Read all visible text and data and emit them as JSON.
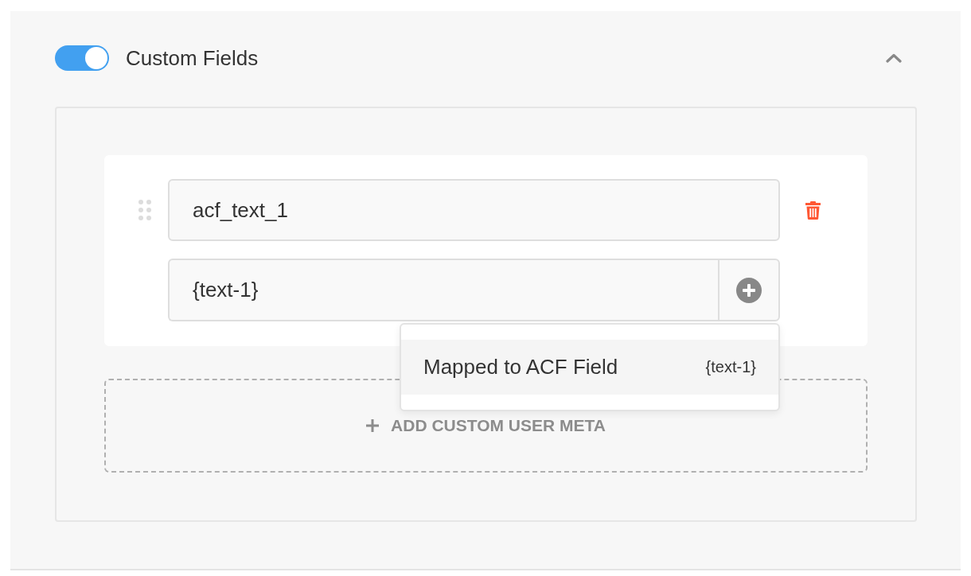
{
  "section": {
    "title": "Custom Fields",
    "enabled": true,
    "expanded": true,
    "fields": [
      {
        "name": "acf_text_1",
        "value": "{text-1}",
        "menu": [
          {
            "label": "Mapped to ACF Field",
            "token": "{text-1}"
          }
        ]
      }
    ],
    "add_button": "ADD CUSTOM USER META"
  }
}
